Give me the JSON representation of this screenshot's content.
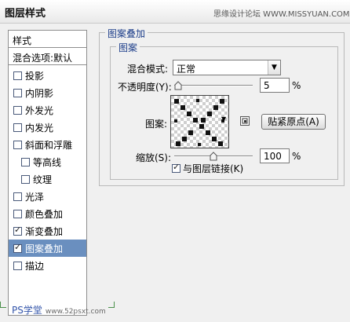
{
  "window": {
    "title": "图层样式",
    "watermark_top": "思缘设计论坛 WWW.MISSYUAN.COM"
  },
  "sidebar": {
    "header": "样式",
    "blend_options": "混合选项:默认",
    "items": [
      {
        "label": "投影",
        "checked": false,
        "indent": false,
        "selected": false
      },
      {
        "label": "内阴影",
        "checked": false,
        "indent": false,
        "selected": false
      },
      {
        "label": "外发光",
        "checked": false,
        "indent": false,
        "selected": false
      },
      {
        "label": "内发光",
        "checked": false,
        "indent": false,
        "selected": false
      },
      {
        "label": "斜面和浮雕",
        "checked": false,
        "indent": false,
        "selected": false
      },
      {
        "label": "等高线",
        "checked": false,
        "indent": true,
        "selected": false
      },
      {
        "label": "纹理",
        "checked": false,
        "indent": true,
        "selected": false
      },
      {
        "label": "光泽",
        "checked": false,
        "indent": false,
        "selected": false
      },
      {
        "label": "颜色叠加",
        "checked": false,
        "indent": false,
        "selected": false
      },
      {
        "label": "渐变叠加",
        "checked": true,
        "indent": false,
        "selected": false
      },
      {
        "label": "图案叠加",
        "checked": true,
        "indent": false,
        "selected": true
      },
      {
        "label": "描边",
        "checked": false,
        "indent": false,
        "selected": false
      }
    ]
  },
  "panel": {
    "legend": "图案叠加",
    "inner_legend": "图案",
    "blend_mode_label": "混合模式:",
    "blend_mode_value": "正常",
    "opacity_label": "不透明度(Y):",
    "opacity_value": "5",
    "opacity_unit": "%",
    "opacity_level": 0.05,
    "pattern_label": "图案:",
    "snap_button": "贴紧原点(A)",
    "scale_label": "缩放(S):",
    "scale_value": "100",
    "scale_unit": "%",
    "scale_level": 0.5,
    "link_label": "与图层链接(K)",
    "link_checked": true
  },
  "watermark_bottom": {
    "main": "PS学堂",
    "sub": "www.52psxt.com"
  },
  "colors": {
    "selection": "#6a8fbf",
    "legend_text": "#1d3e8a",
    "background": "#f0f0f0"
  }
}
